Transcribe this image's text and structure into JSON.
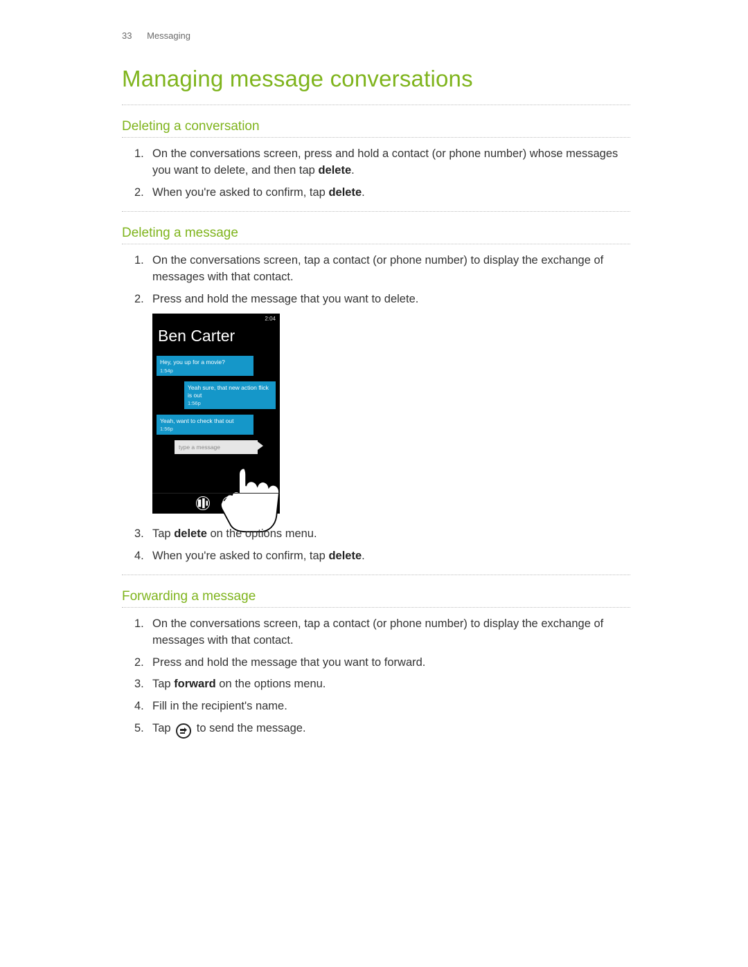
{
  "header": {
    "pagenum": "33",
    "section": "Messaging"
  },
  "title": "Managing message conversations",
  "sections": {
    "deleting_conversation": {
      "heading": "Deleting a conversation",
      "step1_pre": "On the conversations screen, press and hold a contact (or phone number) whose messages you want to delete, and then tap ",
      "step1_bold": "delete",
      "step1_post": ".",
      "step2_pre": "When you're asked to confirm, tap ",
      "step2_bold": "delete",
      "step2_post": "."
    },
    "deleting_message": {
      "heading": "Deleting a message",
      "step1": "On the conversations screen, tap a contact (or phone number) to display the exchange of messages with that contact.",
      "step2": "Press and hold the message that you want to delete.",
      "step3_pre": "Tap ",
      "step3_bold": "delete",
      "step3_post": " on the options menu.",
      "step4_pre": "When you're asked to confirm, tap ",
      "step4_bold": "delete",
      "step4_post": "."
    },
    "forwarding_message": {
      "heading": "Forwarding a message",
      "step1": "On the conversations screen, tap a contact (or phone number) to display the exchange of messages with that contact.",
      "step2": "Press and hold the message that you want to forward.",
      "step3_pre": "Tap ",
      "step3_bold": "forward",
      "step3_post": " on the options menu.",
      "step4": "Fill in the recipient's name.",
      "step5_pre": "Tap ",
      "step5_post": " to send the message."
    }
  },
  "phone": {
    "status_time": "2:04",
    "contact_name": "Ben Carter",
    "msg1": {
      "text": "Hey, you up for a movie?",
      "time": "1:54p"
    },
    "msg2": {
      "text": "Yeah sure, that new action flick is out",
      "time": "1:56p"
    },
    "msg3": {
      "text": "Yeah, want to check that out",
      "time": "1:56p"
    },
    "input_placeholder": "type a message",
    "ellipsis": "..."
  }
}
